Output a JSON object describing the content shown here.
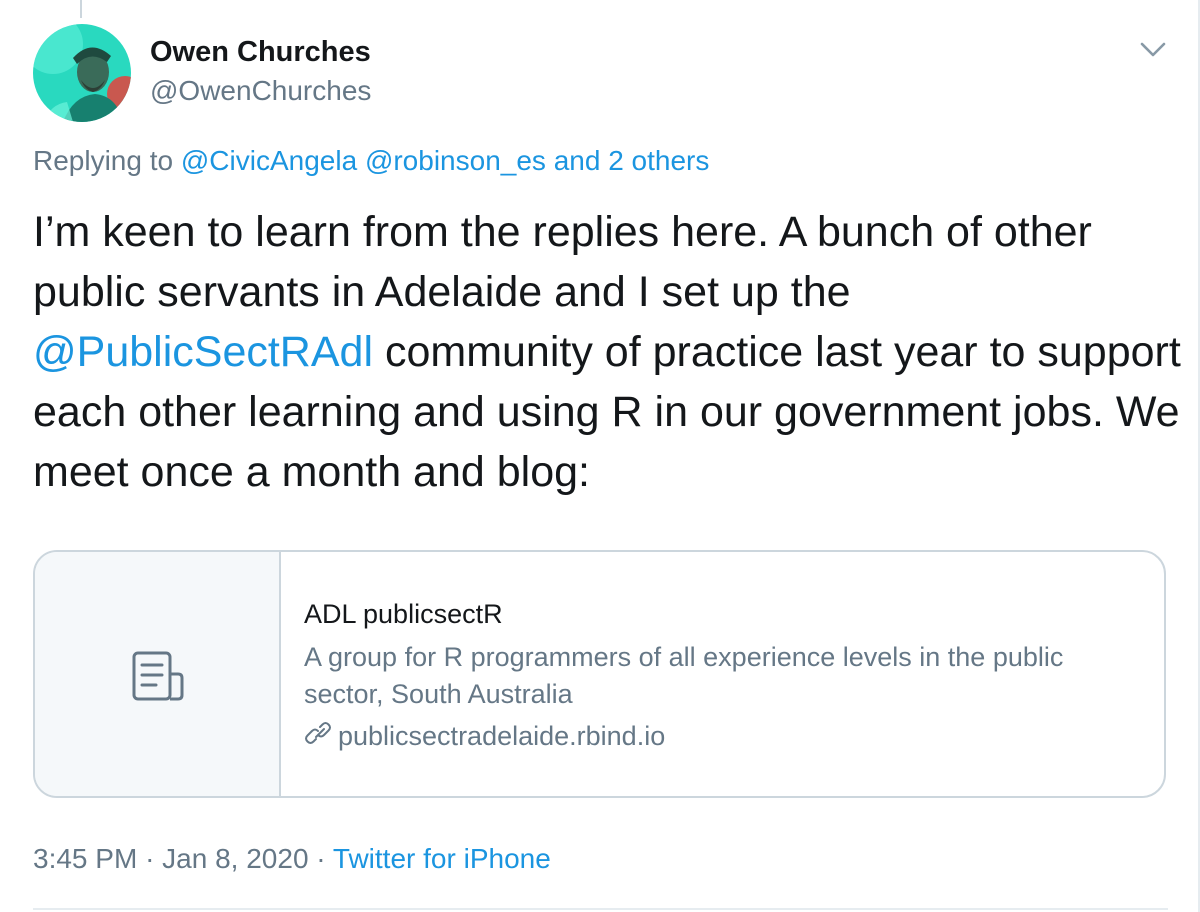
{
  "author": {
    "name": "Owen Churches",
    "handle": "@OwenChurches"
  },
  "reply": {
    "prefix": "Replying to",
    "mentions": [
      "@CivicAngela",
      "@robinson_es"
    ],
    "others": "and 2 others"
  },
  "tweet": {
    "text_part1": "I’m keen to learn from the replies here. A bunch of other public servants in Adelaide and I set up the ",
    "mention": "@PublicSectRAdl",
    "text_part2": " community of practice last year to support each other learning and using R in our government jobs. We meet once a month and blog:"
  },
  "card": {
    "title": "ADL publicsectR",
    "description": "A group for R programmers of all experience levels in the public sector, South Australia",
    "domain": "publicsectradelaide.rbind.io",
    "thumb_icon": "document-icon"
  },
  "meta": {
    "time": "3:45 PM",
    "separator": "·",
    "date": "Jan 8, 2020",
    "source": "Twitter for iPhone"
  },
  "colors": {
    "link": "#1b95e0",
    "secondary_text": "#657786",
    "primary_text": "#14171a",
    "border": "#ccd6dd",
    "avatar_bg": "#2ee0c5"
  },
  "icons": {
    "more": "chevron-down-icon",
    "link": "link-icon"
  }
}
